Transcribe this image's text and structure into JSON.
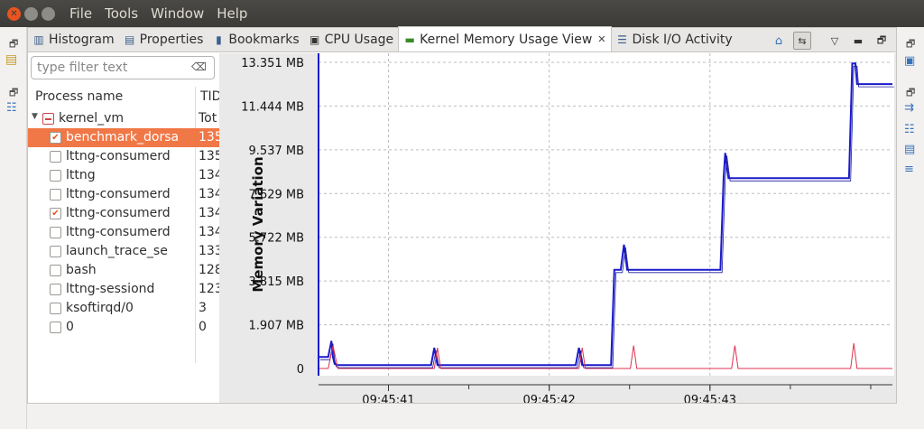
{
  "menubar": {
    "items": [
      {
        "label": "File"
      },
      {
        "label": "Tools"
      },
      {
        "label": "Window"
      },
      {
        "label": "Help"
      }
    ]
  },
  "tabs": [
    {
      "label": "Histogram",
      "icon": "histogram-icon"
    },
    {
      "label": "Properties",
      "icon": "properties-icon"
    },
    {
      "label": "Bookmarks",
      "icon": "bookmarks-icon"
    },
    {
      "label": "CPU Usage",
      "icon": "cpu-icon"
    },
    {
      "label": "Kernel Memory Usage View",
      "icon": "memory-icon",
      "active": true
    },
    {
      "label": "Disk I/O Activity",
      "icon": "disk-io-icon"
    }
  ],
  "tree": {
    "filter_placeholder": "type filter text",
    "col_process": "Process name",
    "col_tid": "TID",
    "root": {
      "name": "kernel_vm",
      "tid": "Tot"
    },
    "rows": [
      {
        "name": "benchmark_dorsa",
        "tid": "135",
        "checked": true,
        "selected": true
      },
      {
        "name": "lttng-consumerd",
        "tid": "135",
        "checked": false
      },
      {
        "name": "lttng",
        "tid": "134",
        "checked": false
      },
      {
        "name": "lttng-consumerd",
        "tid": "134",
        "checked": false
      },
      {
        "name": "lttng-consumerd",
        "tid": "134",
        "checked": true
      },
      {
        "name": "lttng-consumerd",
        "tid": "134",
        "checked": false
      },
      {
        "name": "launch_trace_se",
        "tid": "133",
        "checked": false
      },
      {
        "name": "bash",
        "tid": "128",
        "checked": false
      },
      {
        "name": "lttng-sessiond",
        "tid": "123",
        "checked": false
      },
      {
        "name": "ksoftirqd/0",
        "tid": "3",
        "checked": false
      },
      {
        "name": "0",
        "tid": "0",
        "checked": false
      }
    ]
  },
  "chart_data": {
    "type": "line",
    "title": "",
    "ylabel": "Memory Variation",
    "xlabel": "",
    "ylim": [
      0,
      13.351
    ],
    "yticks": [
      "0",
      "1.907 MB",
      "3.815 MB",
      "5.722 MB",
      "7.629 MB",
      "9.537 MB",
      "11.444 MB",
      "13.351 MB"
    ],
    "ytick_values": [
      0,
      1.907,
      3.815,
      5.722,
      7.629,
      9.537,
      11.444,
      13.351
    ],
    "xticks": [
      "09:45:41",
      "09:45:42",
      "09:45:43"
    ],
    "xtick_values": [
      0.435,
      1.435,
      2.435
    ],
    "xlim": [
      0,
      3.57
    ],
    "grid": true,
    "series": [
      {
        "color": "#1a1acc",
        "x": [
          0,
          0.03,
          0.06,
          0.08,
          0.09,
          0.1,
          0.12,
          0.3,
          0.7,
          0.72,
          0.74,
          1.6,
          1.62,
          1.64,
          1.82,
          1.84,
          1.86,
          1.88,
          1.9,
          1.92,
          2.5,
          2.52,
          2.53,
          2.55,
          2.57,
          3.3,
          3.32,
          3.34,
          3.35,
          3.37,
          3.39,
          3.57
        ],
        "y": [
          0.5,
          0.5,
          0.5,
          1.2,
          0.5,
          0.2,
          0.15,
          0.15,
          0.15,
          0.9,
          0.15,
          0.15,
          0.9,
          0.15,
          0.15,
          4.3,
          4.3,
          4.3,
          5.4,
          4.3,
          4.3,
          8.3,
          9.4,
          8.3,
          8.3,
          8.3,
          13.3,
          13.3,
          12.4,
          12.4,
          12.4,
          12.4
        ]
      },
      {
        "color": "#e03050",
        "x": [
          0,
          0.06,
          0.09,
          0.12,
          0.72,
          0.74,
          0.76,
          1.62,
          1.64,
          1.66,
          1.94,
          1.96,
          1.98,
          2.57,
          2.59,
          2.61,
          3.31,
          3.33,
          3.35,
          3.57
        ],
        "y": [
          0,
          0,
          1.0,
          0,
          0,
          0.9,
          0,
          0,
          0.9,
          0,
          0,
          1.0,
          0,
          0,
          1.0,
          0,
          0,
          1.1,
          0,
          0
        ]
      }
    ]
  }
}
